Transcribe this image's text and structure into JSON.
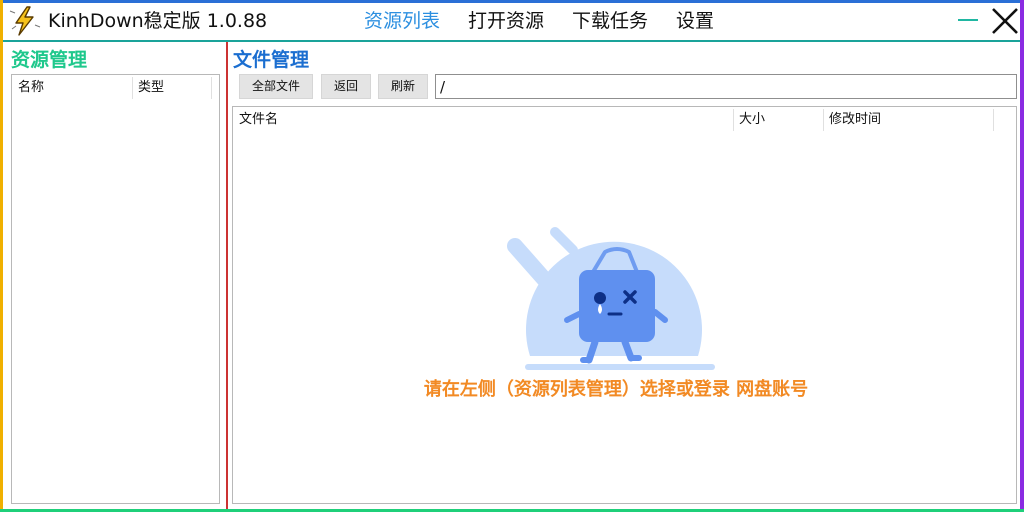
{
  "app": {
    "title": "KinhDown稳定版 1.0.88"
  },
  "nav": {
    "items": [
      {
        "label": "资源列表",
        "active": true
      },
      {
        "label": "打开资源",
        "active": false
      },
      {
        "label": "下载任务",
        "active": false
      },
      {
        "label": "设置",
        "active": false
      }
    ]
  },
  "left_panel": {
    "heading": "资源管理",
    "columns": [
      "名称",
      "类型"
    ]
  },
  "right_panel": {
    "heading": "文件管理",
    "buttons": {
      "all_files": "全部文件",
      "back": "返回",
      "refresh": "刷新"
    },
    "path": "/",
    "columns": [
      "文件名",
      "大小",
      "修改时间"
    ],
    "empty_message": "请在左侧（资源列表管理）选择或登录 网盘账号"
  },
  "colors": {
    "active_nav": "#2c8fe0",
    "left_heading": "#1fc88c",
    "right_heading": "#1b6ed0",
    "empty_message": "#f28a24",
    "minimize": "#20b7a2",
    "separator_red": "#cc3333"
  },
  "icons": [
    "lightning-icon",
    "minimize-icon",
    "close-icon",
    "empty-box-icon"
  ]
}
